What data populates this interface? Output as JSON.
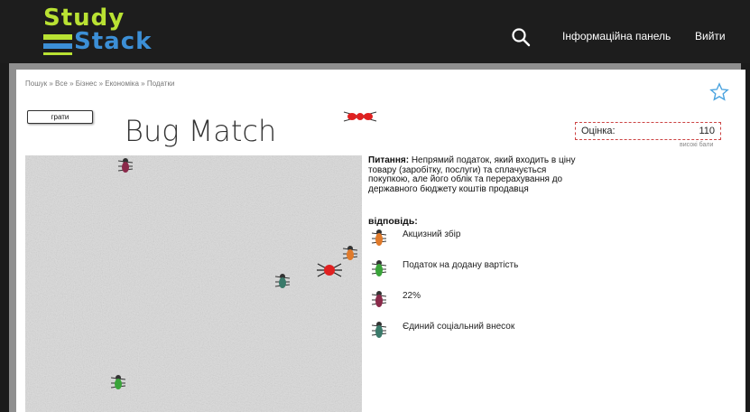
{
  "header": {
    "logo_line1": "Study",
    "logo_line2": "Stack",
    "nav_dashboard": "Інформаційна панель",
    "nav_logout": "Вийти",
    "search_icon": "search-icon"
  },
  "breadcrumb": [
    "Пошук",
    "Все",
    "Бізнес",
    "Економіка",
    "Податки"
  ],
  "breadcrumb_sep": "»",
  "game": {
    "play_label": "грати",
    "title": "Bug Match",
    "score_label": "Оцінка:",
    "score_value": "110",
    "high_score_label": "високі бали"
  },
  "question": {
    "prefix": "Питання:",
    "text": "Непрямий податок, який входить в ціну товару (заробітку, послуги) та сплачується покупкою, але його облік та перерахування до державного бюджету коштів продавця"
  },
  "answers": {
    "header": "відповідь:",
    "items": [
      {
        "text": "Акцизний збір",
        "color": "#e07a2a"
      },
      {
        "text": "Податок на додану вартість",
        "color": "#3aa43a"
      },
      {
        "text": "22%",
        "color": "#8a2a4a"
      },
      {
        "text": "Єдиний соціальний внесок",
        "color": "#3a7a6a"
      }
    ]
  },
  "colors": {
    "topbar": "#1d1d1d",
    "logo_green": "#b9e233",
    "logo_blue": "#3c8fd6",
    "score_border": "#cc4444"
  }
}
